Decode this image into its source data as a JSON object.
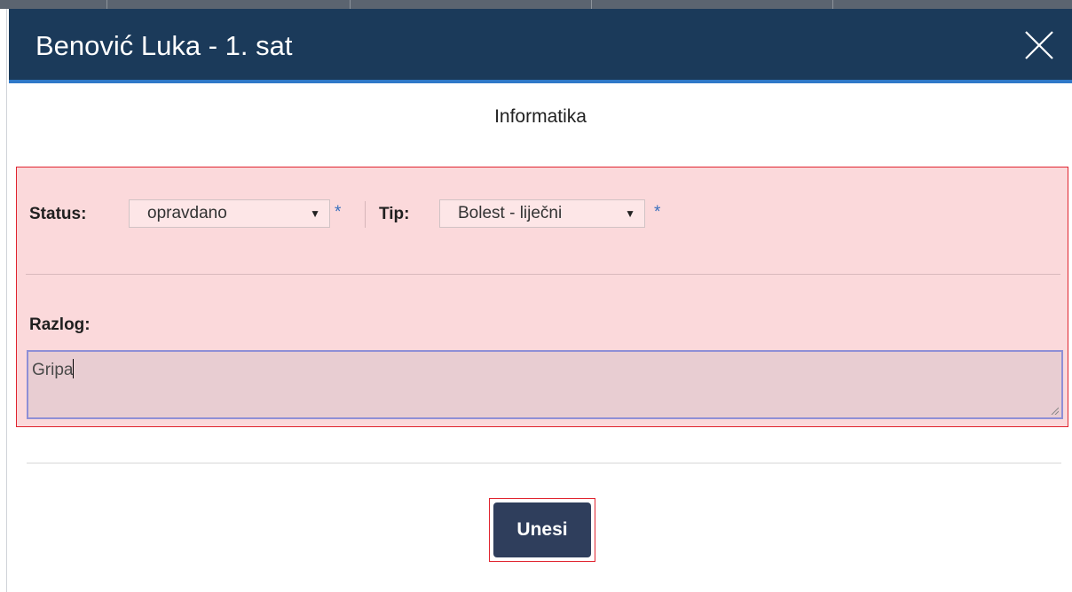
{
  "modal": {
    "title": "Benović Luka - 1. sat",
    "close_icon": "close-icon",
    "subject": "Informatika"
  },
  "form": {
    "status_label": "Status:",
    "status_value": "opravdano",
    "tip_label": "Tip:",
    "tip_value": "Bolest - liječni",
    "required_marker": "*",
    "razlog_label": "Razlog:",
    "razlog_value": "Gripa"
  },
  "actions": {
    "submit_label": "Unesi"
  },
  "colors": {
    "header_bg": "#1b3a5a",
    "header_accent": "#2f78c8",
    "highlight_bg": "#fbd9db",
    "highlight_border": "#e0242f",
    "button_bg": "#2f3e5c",
    "required_star": "#3a6fbd"
  }
}
